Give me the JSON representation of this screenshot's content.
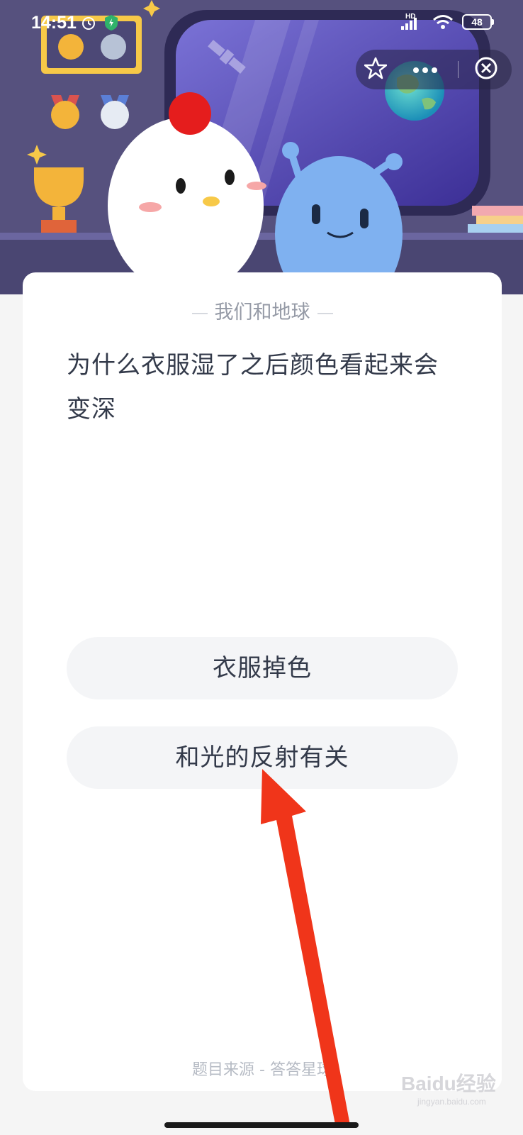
{
  "status_bar": {
    "time": "14:51",
    "network": "HD",
    "battery": "48"
  },
  "capsule": {
    "favorite_icon": "star-outline-icon",
    "more_icon": "more-dots-icon",
    "close_icon": "close-circle-icon"
  },
  "quiz": {
    "category": "我们和地球",
    "question": "为什么衣服湿了之后颜色看起来会变深",
    "options": [
      {
        "label": "衣服掉色"
      },
      {
        "label": "和光的反射有关"
      }
    ],
    "source": "题目来源 - 答答星球"
  },
  "annotation": {
    "arrow_color": "#f0351a"
  },
  "watermark": {
    "brand": "Baidu经验",
    "url": "jingyan.baidu.com"
  }
}
